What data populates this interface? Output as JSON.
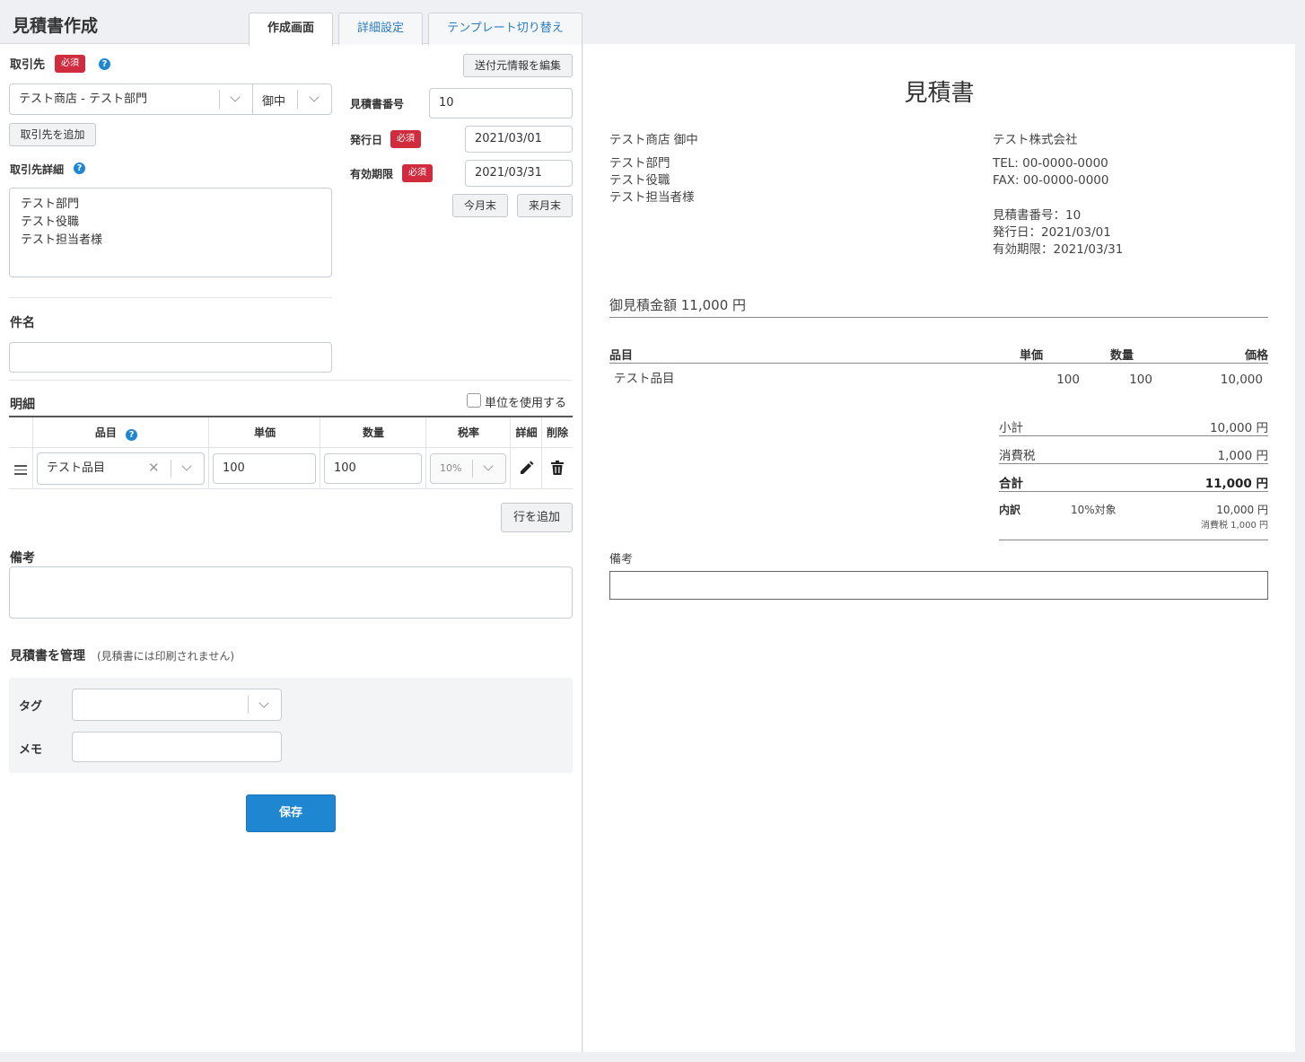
{
  "header": {
    "title": "見積書作成",
    "tabs": [
      {
        "label": "作成画面",
        "active": true
      },
      {
        "label": "詳細設定",
        "active": false
      },
      {
        "label": "テンプレート切り替え",
        "active": false
      }
    ]
  },
  "form": {
    "client_label": "取引先",
    "required_label": "必須",
    "edit_sender_button": "送付元情報を編集",
    "client_select_value": "テスト商店 - テスト部門",
    "honorific_select_value": "御中",
    "add_client_button": "取引先を追加",
    "client_detail_label": "取引先詳細",
    "client_detail_lines": [
      "テスト部門",
      "テスト役職",
      "テスト担当者様"
    ],
    "estimate_number_label": "見積書番号",
    "estimate_number_value": "10",
    "issue_date_label": "発行日",
    "issue_date_value": "2021/03/01",
    "expiry_label": "有効期限",
    "expiry_value": "2021/03/31",
    "end_of_month_button": "今月末",
    "end_of_next_month_button": "来月末",
    "subject_label": "件名",
    "subject_value": "",
    "details_label": "明細",
    "use_unit_label": "単位を使用する",
    "table_headers": {
      "item": "品目",
      "unit_price": "単価",
      "quantity": "数量",
      "tax_rate": "税率",
      "detail": "詳細",
      "delete": "削除"
    },
    "rows": [
      {
        "item": "テスト品目",
        "unit_price": "100",
        "quantity": "100",
        "tax_rate": "10%"
      }
    ],
    "add_row_button": "行を追加",
    "remarks_label": "備考",
    "remarks_value": "",
    "manage_label": "見積書を管理",
    "manage_note": "(見積書には印刷されません)",
    "tag_label": "タグ",
    "memo_label": "メモ",
    "save_button": "保存",
    "colors": {
      "primary": "#1f87d1",
      "required": "#d02c3e"
    }
  },
  "preview": {
    "title": "見積書",
    "client_name": "テスト商店 御中",
    "client_lines": [
      "テスト部門",
      "テスト役職",
      "テスト担当者様"
    ],
    "company_name": "テスト株式会社",
    "tel": "TEL: 00-0000-0000",
    "fax": "FAX: 00-0000-0000",
    "estimate_number": "見積書番号：10",
    "issue_date": "発行日：2021/03/01",
    "expiry": "有効期限：2021/03/31",
    "total_line": "御見積金額 11,000 円",
    "headers": {
      "item": "品目",
      "unit_price": "単価",
      "quantity": "数量",
      "price": "価格"
    },
    "rows": [
      {
        "item": "テスト品目",
        "unit_price": "100",
        "quantity": "100",
        "price": "10,000"
      }
    ],
    "subtotal_label": "小計",
    "subtotal_value": "10,000 円",
    "tax_label": "消費税",
    "tax_value": "1,000 円",
    "grand_total_label": "合計",
    "grand_total_value": "11,000 円",
    "breakdown_label": "内訳",
    "breakdown_target": "10%対象",
    "breakdown_amount": "10,000 円",
    "breakdown_tax": "消費税 1,000 円",
    "remarks_label": "備考"
  }
}
